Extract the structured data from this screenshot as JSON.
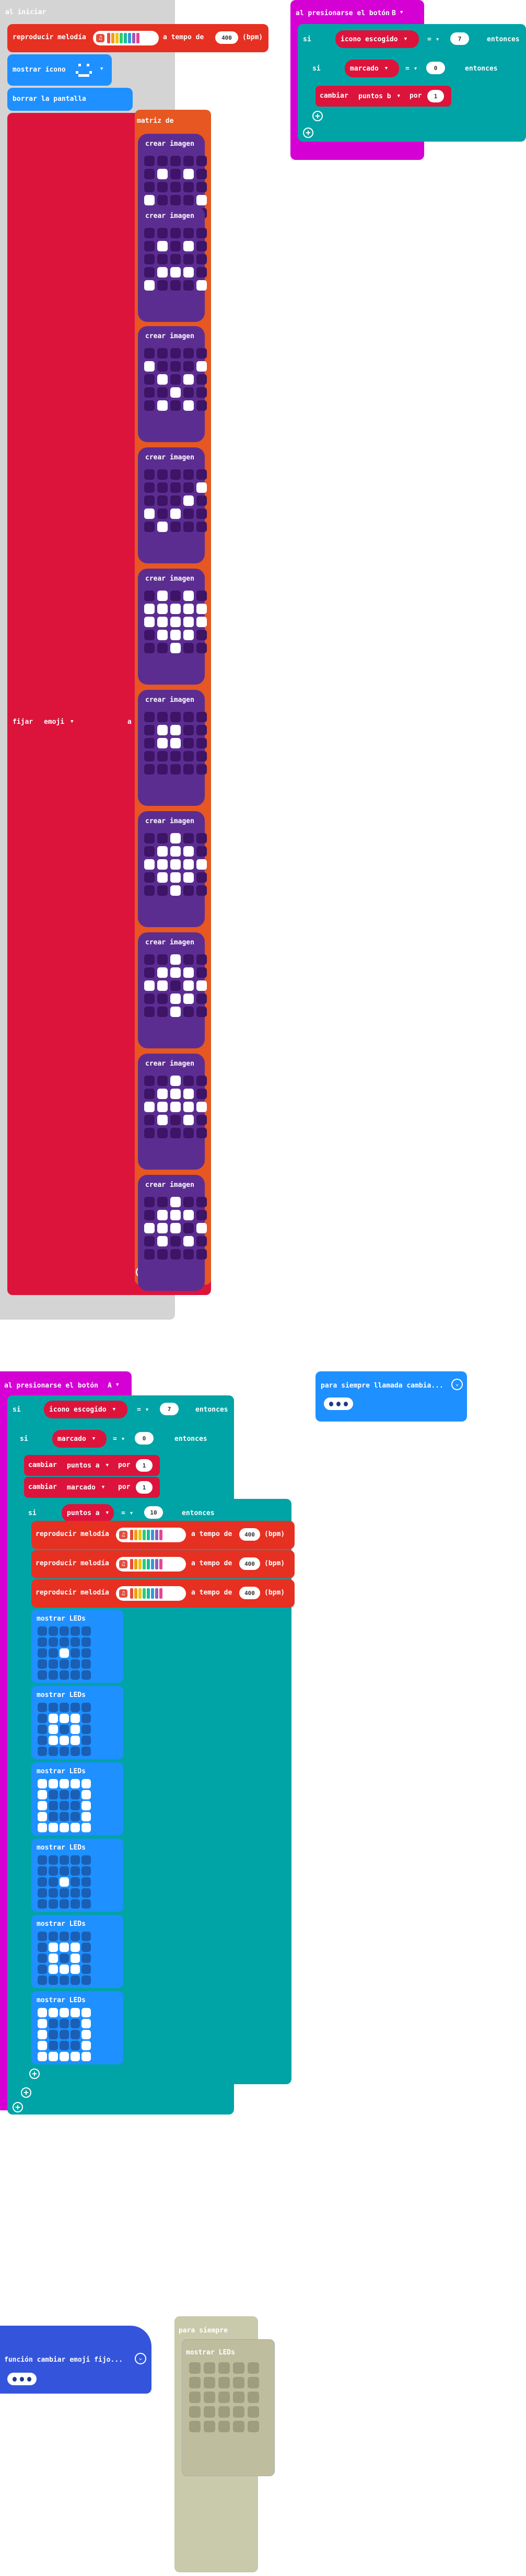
{
  "colors": {
    "on_start": "#d4d4d4",
    "music": "#e63022",
    "basic": "#1e90ff",
    "images": "#5c2d91",
    "image_array": "#e65722",
    "variables": "#dc143c",
    "logic": "#00a4a6",
    "input": "#d400d4",
    "function": "#3455db",
    "disabled": "#c6c6a8"
  },
  "icons": [
    "music-note-icon",
    "plus-icon",
    "minus-icon",
    "dropdown-chevron-icon",
    "smiley-icon"
  ],
  "on_start": {
    "header": "al iniciar",
    "play_melody": {
      "label": "reproducir melodía",
      "tempo_label": "a tempo de",
      "tempo": "400",
      "unit": "(bpm)"
    },
    "show_icon": {
      "label": "mostrar ícono"
    },
    "clear_screen": {
      "label": "borrar la pantalla"
    },
    "set_emoji": {
      "label": "fijar",
      "var": "emoji",
      "to": "a"
    },
    "array": {
      "label": "matriz de"
    },
    "create_image_label": "crear imagen"
  },
  "on_button_b": {
    "header": "al presionarse el botón",
    "button": "B",
    "if1": {
      "label": "si",
      "var": "icono escogido",
      "op": "=",
      "value": "7",
      "then": "entonces"
    },
    "if2": {
      "label": "si",
      "var": "marcado",
      "op": "=",
      "value": "0",
      "then": "entonces"
    },
    "change": {
      "label": "cambiar",
      "var": "puntos b",
      "by": "por",
      "value": "1"
    }
  },
  "on_button_a": {
    "header": "al presionarse el botón",
    "button": "A",
    "if1": {
      "label": "si",
      "var": "icono escogido",
      "op": "=",
      "value": "7",
      "then": "entonces"
    },
    "if2": {
      "label": "si",
      "var": "marcado",
      "op": "=",
      "value": "0",
      "then": "entonces"
    },
    "change1": {
      "label": "cambiar",
      "var": "puntos a",
      "by": "por",
      "value": "1"
    },
    "change2": {
      "label": "cambiar",
      "var": "marcado",
      "by": "por",
      "value": "1"
    },
    "if3": {
      "label": "si",
      "var": "puntos a",
      "op": "=",
      "value": "10",
      "then": "entonces"
    },
    "melody": {
      "label": "reproducir melodía",
      "tempo_label": "a tempo de",
      "tempo": "400",
      "unit": "(bpm)"
    },
    "show_leds_label": "mostrar LEDs"
  },
  "forever_call": {
    "header": "para siempre llamada cambia..."
  },
  "function_def": {
    "header": "función cambiar emoji fijo..."
  },
  "forever_disabled": {
    "header": "para siempre",
    "show_leds_label": "mostrar LEDs"
  },
  "images": [
    [
      0,
      0,
      0,
      0,
      0,
      0,
      1,
      0,
      1,
      0,
      0,
      0,
      0,
      0,
      0,
      1,
      0,
      0,
      0,
      1,
      0,
      1,
      1,
      1,
      0
    ],
    [
      0,
      0,
      0,
      0,
      0,
      0,
      1,
      0,
      1,
      0,
      0,
      0,
      0,
      0,
      0,
      0,
      1,
      1,
      1,
      0,
      1,
      0,
      0,
      0,
      1
    ],
    [
      0,
      0,
      0,
      0,
      0,
      1,
      0,
      0,
      0,
      1,
      0,
      1,
      0,
      1,
      0,
      0,
      0,
      1,
      0,
      0,
      0,
      1,
      0,
      1,
      0
    ],
    [
      0,
      0,
      0,
      0,
      0,
      0,
      0,
      0,
      0,
      1,
      0,
      0,
      0,
      1,
      0,
      1,
      0,
      1,
      0,
      0,
      0,
      1,
      0,
      0,
      0
    ],
    [
      0,
      1,
      0,
      1,
      0,
      1,
      1,
      1,
      1,
      1,
      1,
      1,
      1,
      1,
      1,
      0,
      1,
      1,
      1,
      0,
      0,
      0,
      1,
      0,
      0
    ],
    [
      0,
      0,
      0,
      0,
      0,
      0,
      1,
      1,
      0,
      0,
      0,
      1,
      1,
      0,
      0,
      0,
      0,
      0,
      0,
      0,
      0,
      0,
      0,
      0,
      0
    ],
    [
      0,
      0,
      1,
      0,
      0,
      0,
      1,
      1,
      1,
      0,
      1,
      1,
      1,
      1,
      1,
      0,
      1,
      1,
      1,
      0,
      0,
      0,
      1,
      0,
      0
    ],
    [
      0,
      0,
      1,
      0,
      0,
      0,
      1,
      1,
      1,
      0,
      1,
      1,
      0,
      1,
      1,
      0,
      0,
      1,
      1,
      0,
      0,
      0,
      1,
      0,
      0
    ],
    [
      0,
      0,
      1,
      0,
      0,
      0,
      1,
      1,
      1,
      0,
      1,
      1,
      1,
      1,
      1,
      0,
      1,
      0,
      1,
      0,
      0,
      0,
      0,
      0,
      0
    ],
    [
      0,
      0,
      1,
      0,
      0,
      0,
      1,
      1,
      1,
      0,
      1,
      1,
      1,
      0,
      1,
      0,
      1,
      0,
      1,
      0,
      0,
      0,
      0,
      0,
      0
    ]
  ],
  "leds": [
    [
      0,
      0,
      0,
      0,
      0,
      0,
      0,
      0,
      0,
      0,
      0,
      0,
      1,
      0,
      0,
      0,
      0,
      0,
      0,
      0,
      0,
      0,
      0,
      0,
      0
    ],
    [
      0,
      0,
      0,
      0,
      0,
      0,
      1,
      1,
      1,
      0,
      0,
      1,
      0,
      1,
      0,
      0,
      1,
      1,
      1,
      0,
      0,
      0,
      0,
      0,
      0
    ],
    [
      1,
      1,
      1,
      1,
      1,
      1,
      0,
      0,
      0,
      1,
      1,
      0,
      0,
      0,
      1,
      1,
      0,
      0,
      0,
      1,
      1,
      1,
      1,
      1,
      1
    ],
    [
      0,
      0,
      0,
      0,
      0,
      0,
      0,
      0,
      0,
      0,
      0,
      0,
      1,
      0,
      0,
      0,
      0,
      0,
      0,
      0,
      0,
      0,
      0,
      0,
      0
    ],
    [
      0,
      0,
      0,
      0,
      0,
      0,
      1,
      1,
      1,
      0,
      0,
      1,
      0,
      1,
      0,
      0,
      1,
      1,
      1,
      0,
      0,
      0,
      0,
      0,
      0
    ],
    [
      1,
      1,
      1,
      1,
      1,
      1,
      0,
      0,
      0,
      1,
      1,
      0,
      0,
      0,
      1,
      1,
      0,
      0,
      0,
      1,
      1,
      1,
      1,
      1,
      1
    ]
  ]
}
